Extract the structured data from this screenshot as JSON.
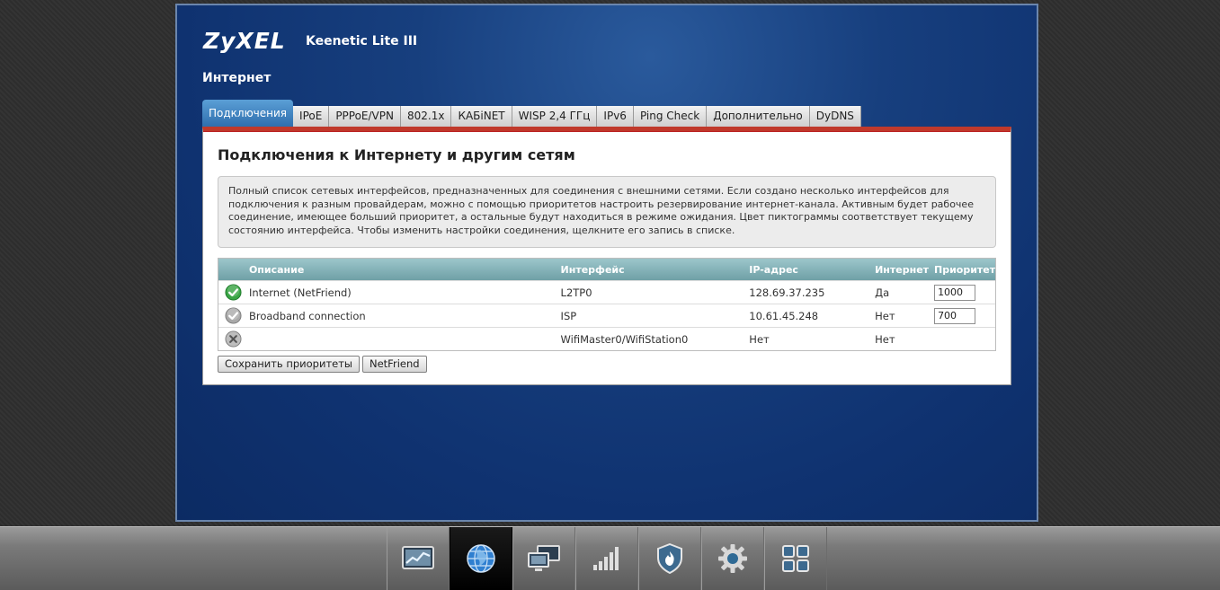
{
  "header": {
    "brand": "ZyXEL",
    "model": "Keenetic Lite III",
    "section": "Интернет"
  },
  "tabs": [
    {
      "label": "Подключения",
      "active": true
    },
    {
      "label": "IPoE"
    },
    {
      "label": "PPPoE/VPN"
    },
    {
      "label": "802.1x"
    },
    {
      "label": "КАБiNET"
    },
    {
      "label": "WISP 2,4 ГГц"
    },
    {
      "label": "IPv6"
    },
    {
      "label": "Ping Check"
    },
    {
      "label": "Дополнительно"
    },
    {
      "label": "DyDNS"
    }
  ],
  "panel": {
    "title": "Подключения к Интернету и другим сетям",
    "description": "Полный список сетевых интерфейсов, предназначенных для соединения с внешними сетями. Если создано несколько интерфейсов для подключения к разным провайдерам, можно с помощью приоритетов настроить резервирование интернет-канала. Активным будет рабочее соединение, имеющее больший приоритет, а остальные будут находиться в режиме ожидания. Цвет пиктограммы соответствует текущему состоянию интерфейса. Чтобы изменить настройки соединения, щелкните его запись в списке."
  },
  "table": {
    "columns": [
      "Описание",
      "Интерфейс",
      "IP-адрес",
      "Интернет",
      "Приоритет"
    ],
    "rows": [
      {
        "status": "check-green-icon",
        "description": "Internet (NetFriend)",
        "interface": "L2TP0",
        "ip": "128.69.37.235",
        "internet": "Да",
        "priority": "1000"
      },
      {
        "status": "check-gray-icon",
        "description": "Broadband connection",
        "interface": "ISP",
        "ip": "10.61.45.248",
        "internet": "Нет",
        "priority": "700"
      },
      {
        "status": "cross-gray-icon",
        "description": "",
        "interface": "WifiMaster0/WifiStation0",
        "ip": "Нет",
        "internet": "Нет",
        "priority": ""
      }
    ]
  },
  "buttons": {
    "save": "Сохранить приоритеты",
    "netfriend": "NetFriend"
  },
  "bottom_nav": [
    {
      "icon": "monitor-chart-icon"
    },
    {
      "icon": "globe-icon",
      "active": true
    },
    {
      "icon": "network-computers-icon"
    },
    {
      "icon": "signal-bars-icon"
    },
    {
      "icon": "shield-fire-icon"
    },
    {
      "icon": "gear-icon"
    },
    {
      "icon": "apps-grid-icon"
    }
  ],
  "colors": {
    "accent_red": "#c0392b",
    "tab_active": "#2f6fae",
    "table_header": "#7fb0b5",
    "background_blue": "#173f7e"
  }
}
